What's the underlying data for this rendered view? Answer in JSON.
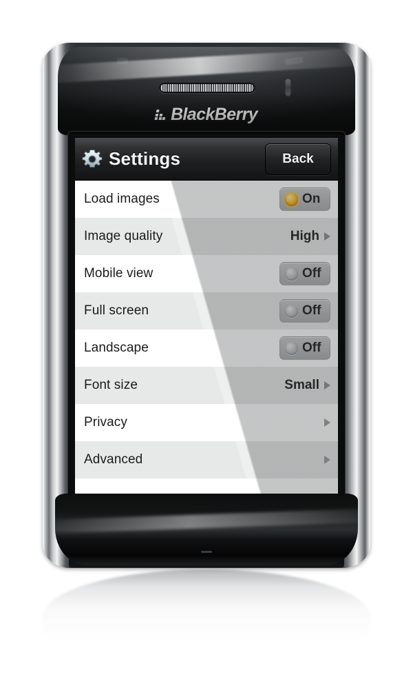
{
  "device": {
    "brand_text": "BlackBerry",
    "brand_mark": "blackberry-dots-logo",
    "speaker": "earpiece-speaker-grille",
    "led": "notification-led",
    "microphone": "microphone-hole"
  },
  "titlebar": {
    "icon": "gear-icon",
    "title": "Settings",
    "back_label": "Back"
  },
  "settings": {
    "rows": [
      {
        "label": "Load images",
        "control": "toggle",
        "value": "On",
        "state": "on"
      },
      {
        "label": "Image quality",
        "control": "value",
        "value": "High",
        "state": ""
      },
      {
        "label": "Mobile view",
        "control": "toggle",
        "value": "Off",
        "state": "off"
      },
      {
        "label": "Full screen",
        "control": "toggle",
        "value": "Off",
        "state": "off"
      },
      {
        "label": "Landscape",
        "control": "toggle",
        "value": "Off",
        "state": "off"
      },
      {
        "label": "Font size",
        "control": "value",
        "value": "Small",
        "state": ""
      },
      {
        "label": "Privacy",
        "control": "chevron",
        "value": "",
        "state": ""
      },
      {
        "label": "Advanced",
        "control": "chevron",
        "value": "",
        "state": ""
      }
    ]
  },
  "hardware_keys": [
    {
      "name": "call-send-key",
      "icon": "green-handset-icon"
    },
    {
      "name": "blackberry-menu-key",
      "icon": "blackberry-dots-icon"
    },
    {
      "name": "back-key",
      "icon": "back-arrow-icon"
    },
    {
      "name": "call-end-power-key",
      "icon": "red-handset-power-icon"
    }
  ],
  "colors": {
    "lamp_on": "#fdc430",
    "lamp_off": "#bfc2c3",
    "row_odd": "#ffffff",
    "row_even": "#e7e8e8",
    "titlebar": "#1c1e1f",
    "call_green": "#1a9b45",
    "end_red": "#c3161c"
  }
}
